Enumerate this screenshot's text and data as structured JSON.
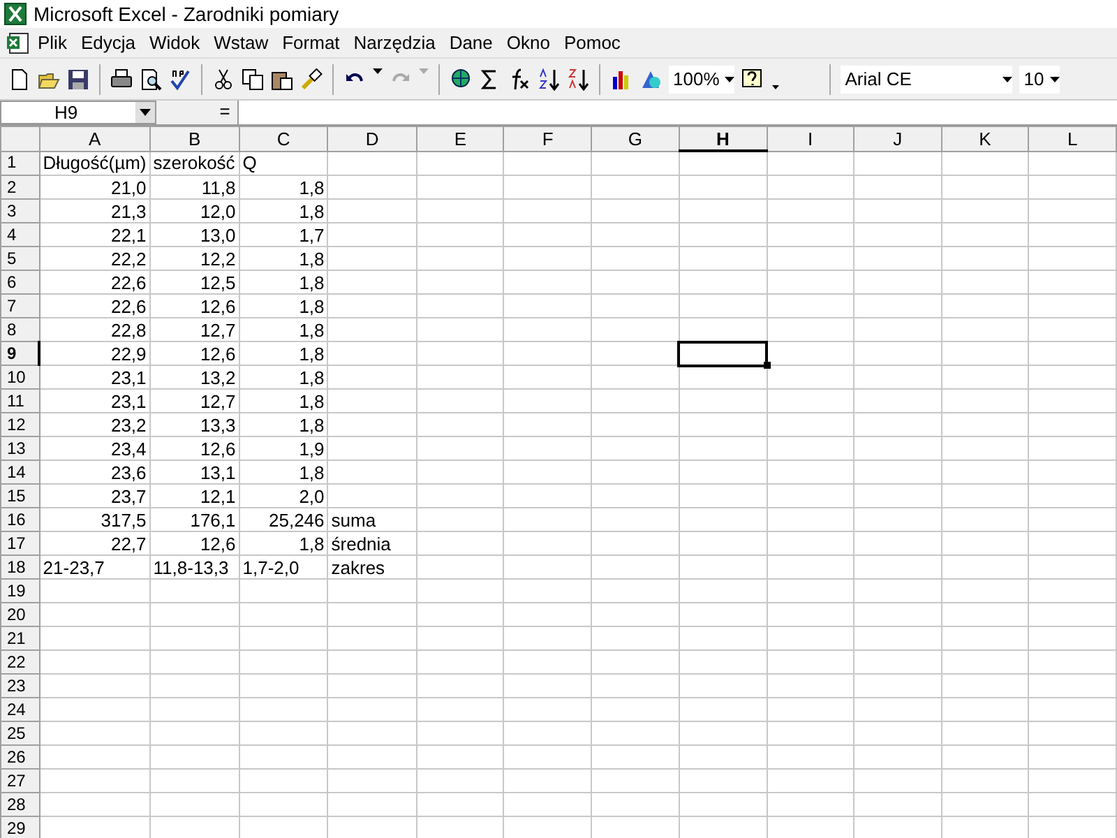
{
  "window": {
    "title": "Microsoft Excel - Zarodniki pomiary"
  },
  "menu": [
    "Plik",
    "Edycja",
    "Widok",
    "Wstaw",
    "Format",
    "Narzędzia",
    "Dane",
    "Okno",
    "Pomoc"
  ],
  "toolbar": {
    "zoom": "100%",
    "font": "Arial CE",
    "font_size": "10"
  },
  "formula_bar": {
    "name_box": "H9",
    "equals": "="
  },
  "columns": [
    {
      "label": "A",
      "selected": false
    },
    {
      "label": "B",
      "selected": false
    },
    {
      "label": "C",
      "selected": false
    },
    {
      "label": "D",
      "selected": false
    },
    {
      "label": "E",
      "selected": false
    },
    {
      "label": "F",
      "selected": false
    },
    {
      "label": "G",
      "selected": false
    },
    {
      "label": "H",
      "selected": true
    },
    {
      "label": "I",
      "selected": false
    },
    {
      "label": "J",
      "selected": false
    },
    {
      "label": "K",
      "selected": false
    },
    {
      "label": "L",
      "selected": false
    }
  ],
  "rows": [
    {
      "label": "1",
      "selected": false,
      "cells": [
        {
          "text": "Długość(µm)",
          "kind": "text"
        },
        {
          "text": "szerokość",
          "kind": "text"
        },
        {
          "text": "Q",
          "kind": "text"
        }
      ]
    },
    {
      "label": "2",
      "selected": false,
      "cells": [
        {
          "text": "21,0",
          "kind": "number"
        },
        {
          "text": "11,8",
          "kind": "number"
        },
        {
          "text": "1,8",
          "kind": "number"
        }
      ]
    },
    {
      "label": "3",
      "selected": false,
      "cells": [
        {
          "text": "21,3",
          "kind": "number"
        },
        {
          "text": "12,0",
          "kind": "number"
        },
        {
          "text": "1,8",
          "kind": "number"
        }
      ]
    },
    {
      "label": "4",
      "selected": false,
      "cells": [
        {
          "text": "22,1",
          "kind": "number"
        },
        {
          "text": "13,0",
          "kind": "number"
        },
        {
          "text": "1,7",
          "kind": "number"
        }
      ]
    },
    {
      "label": "5",
      "selected": false,
      "cells": [
        {
          "text": "22,2",
          "kind": "number"
        },
        {
          "text": "12,2",
          "kind": "number"
        },
        {
          "text": "1,8",
          "kind": "number"
        }
      ]
    },
    {
      "label": "6",
      "selected": false,
      "cells": [
        {
          "text": "22,6",
          "kind": "number"
        },
        {
          "text": "12,5",
          "kind": "number"
        },
        {
          "text": "1,8",
          "kind": "number"
        }
      ]
    },
    {
      "label": "7",
      "selected": false,
      "cells": [
        {
          "text": "22,6",
          "kind": "number"
        },
        {
          "text": "12,6",
          "kind": "number"
        },
        {
          "text": "1,8",
          "kind": "number"
        }
      ]
    },
    {
      "label": "8",
      "selected": false,
      "cells": [
        {
          "text": "22,8",
          "kind": "number"
        },
        {
          "text": "12,7",
          "kind": "number"
        },
        {
          "text": "1,8",
          "kind": "number"
        }
      ]
    },
    {
      "label": "9",
      "selected": true,
      "cells": [
        {
          "text": "22,9",
          "kind": "number"
        },
        {
          "text": "12,6",
          "kind": "number"
        },
        {
          "text": "1,8",
          "kind": "number"
        }
      ]
    },
    {
      "label": "10",
      "selected": false,
      "cells": [
        {
          "text": "23,1",
          "kind": "number"
        },
        {
          "text": "13,2",
          "kind": "number"
        },
        {
          "text": "1,8",
          "kind": "number"
        }
      ]
    },
    {
      "label": "11",
      "selected": false,
      "cells": [
        {
          "text": "23,1",
          "kind": "number"
        },
        {
          "text": "12,7",
          "kind": "number"
        },
        {
          "text": "1,8",
          "kind": "number"
        }
      ]
    },
    {
      "label": "12",
      "selected": false,
      "cells": [
        {
          "text": "23,2",
          "kind": "number"
        },
        {
          "text": "13,3",
          "kind": "number"
        },
        {
          "text": "1,8",
          "kind": "number"
        }
      ]
    },
    {
      "label": "13",
      "selected": false,
      "cells": [
        {
          "text": "23,4",
          "kind": "number"
        },
        {
          "text": "12,6",
          "kind": "number"
        },
        {
          "text": "1,9",
          "kind": "number"
        }
      ]
    },
    {
      "label": "14",
      "selected": false,
      "cells": [
        {
          "text": "23,6",
          "kind": "number"
        },
        {
          "text": "13,1",
          "kind": "number"
        },
        {
          "text": "1,8",
          "kind": "number"
        }
      ]
    },
    {
      "label": "15",
      "selected": false,
      "cells": [
        {
          "text": "23,7",
          "kind": "number"
        },
        {
          "text": "12,1",
          "kind": "number"
        },
        {
          "text": "2,0",
          "kind": "number"
        }
      ]
    },
    {
      "label": "16",
      "selected": false,
      "cells": [
        {
          "text": "317,5",
          "kind": "number"
        },
        {
          "text": "176,1",
          "kind": "number"
        },
        {
          "text": "25,246",
          "kind": "number"
        },
        {
          "text": "suma",
          "kind": "text"
        }
      ]
    },
    {
      "label": "17",
      "selected": false,
      "cells": [
        {
          "text": "22,7",
          "kind": "number"
        },
        {
          "text": "12,6",
          "kind": "number"
        },
        {
          "text": "1,8",
          "kind": "number"
        },
        {
          "text": "średnia",
          "kind": "text"
        }
      ]
    },
    {
      "label": "18",
      "selected": false,
      "cells": [
        {
          "text": "21-23,7",
          "kind": "text"
        },
        {
          "text": "11,8-13,3",
          "kind": "text"
        },
        {
          "text": "1,7-2,0",
          "kind": "text"
        },
        {
          "text": "zakres",
          "kind": "text"
        }
      ]
    },
    {
      "label": "19",
      "selected": false
    },
    {
      "label": "20",
      "selected": false
    },
    {
      "label": "21",
      "selected": false
    },
    {
      "label": "22",
      "selected": false
    },
    {
      "label": "23",
      "selected": false
    },
    {
      "label": "24",
      "selected": false
    },
    {
      "label": "25",
      "selected": false
    },
    {
      "label": "26",
      "selected": false
    },
    {
      "label": "27",
      "selected": false
    },
    {
      "label": "28",
      "selected": false
    },
    {
      "label": "29",
      "selected": false
    }
  ]
}
